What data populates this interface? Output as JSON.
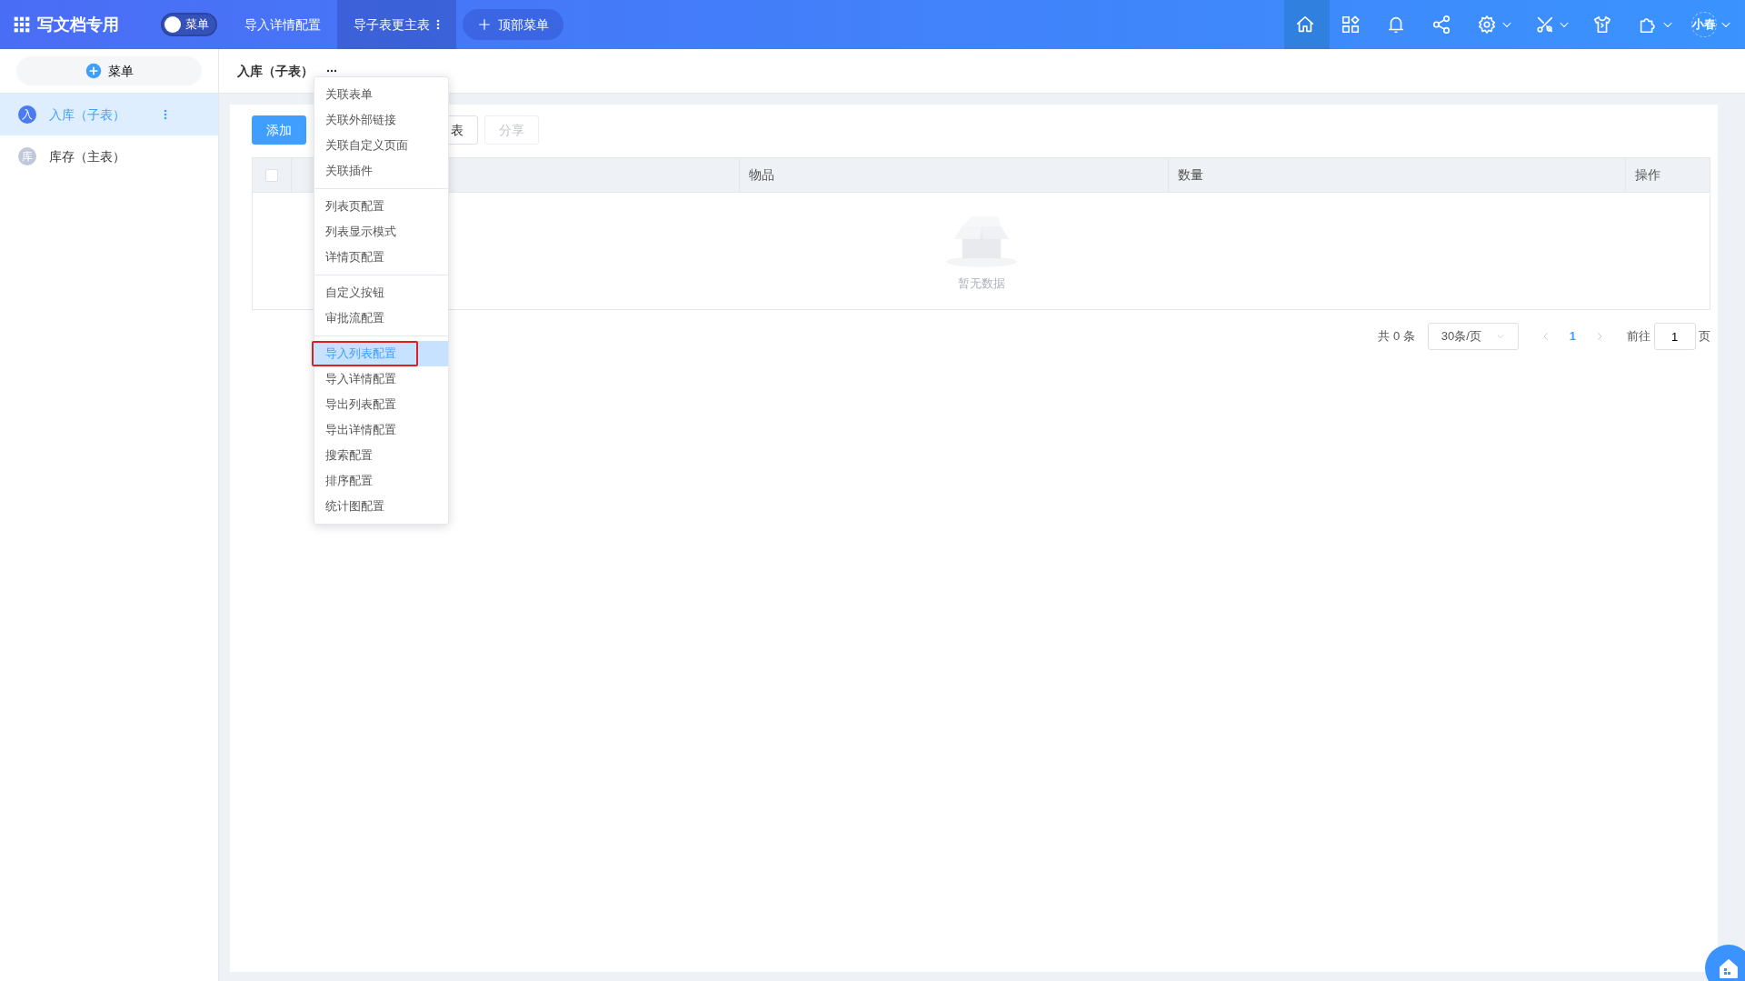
{
  "topbar": {
    "title": "写文档专用",
    "menu_toggle": {
      "label": "菜单",
      "on": false
    },
    "tabs": [
      {
        "label": "导入详情配置",
        "selected": false,
        "has_menu": false
      },
      {
        "label": "导子表更主表",
        "selected": true,
        "has_menu": true
      }
    ],
    "add_menu": "顶部菜单",
    "tools": [
      {
        "kind": "home",
        "selected": true,
        "caret": false
      },
      {
        "kind": "apps",
        "selected": false,
        "caret": false
      },
      {
        "kind": "bell",
        "selected": false,
        "caret": false
      },
      {
        "kind": "share",
        "selected": false,
        "caret": false
      },
      {
        "kind": "gear",
        "selected": false,
        "caret": true
      },
      {
        "kind": "tools",
        "selected": false,
        "caret": true
      },
      {
        "kind": "shirt",
        "selected": false,
        "caret": false
      },
      {
        "kind": "puzzle",
        "selected": false,
        "caret": true
      }
    ],
    "user": {
      "name": "小春"
    }
  },
  "sidebar": {
    "add_button": "菜单",
    "items": [
      {
        "avatar": "入",
        "label": "入库（子表）",
        "selected": true
      },
      {
        "avatar": "库",
        "label": "库存（主表）",
        "selected": false
      }
    ]
  },
  "breadcrumb": {
    "title": "入库（子表）"
  },
  "actions": [
    {
      "label": "添加",
      "kind": "primary",
      "disabled": false
    },
    {
      "label": "表",
      "kind": "covered",
      "disabled": false
    },
    {
      "label": "分享",
      "kind": "default",
      "disabled": true
    }
  ],
  "table": {
    "select_all": {
      "checked": false
    },
    "columns": [
      {
        "label": "物品"
      },
      {
        "label": "数量"
      },
      {
        "label": "操作"
      }
    ],
    "empty_text": "暂无数据"
  },
  "pagination": {
    "total": "共 0 条",
    "page_size": "30条/页",
    "pages": [
      {
        "label": "1",
        "selected": true
      }
    ],
    "goto_label": "前往",
    "goto_value": "1",
    "goto_suffix": "页"
  },
  "dropdown": {
    "groups": [
      [
        {
          "label": "关联表单",
          "selected": false,
          "outlined": false
        },
        {
          "label": "关联外部链接",
          "selected": false,
          "outlined": false
        },
        {
          "label": "关联自定义页面",
          "selected": false,
          "outlined": false
        },
        {
          "label": "关联插件",
          "selected": false,
          "outlined": false
        }
      ],
      [
        {
          "label": "列表页配置",
          "selected": false,
          "outlined": false
        },
        {
          "label": "列表显示模式",
          "selected": false,
          "outlined": false
        },
        {
          "label": "详情页配置",
          "selected": false,
          "outlined": false
        }
      ],
      [
        {
          "label": "自定义按钮",
          "selected": false,
          "outlined": false
        },
        {
          "label": "审批流配置",
          "selected": false,
          "outlined": false
        }
      ],
      [
        {
          "label": "导入列表配置",
          "selected": true,
          "outlined": true
        },
        {
          "label": "导入详情配置",
          "selected": false,
          "outlined": false
        },
        {
          "label": "导出列表配置",
          "selected": false,
          "outlined": false
        },
        {
          "label": "导出详情配置",
          "selected": false,
          "outlined": false
        },
        {
          "label": "搜索配置",
          "selected": false,
          "outlined": false
        },
        {
          "label": "排序配置",
          "selected": false,
          "outlined": false
        },
        {
          "label": "统计图配置",
          "selected": false,
          "outlined": false
        }
      ]
    ]
  }
}
